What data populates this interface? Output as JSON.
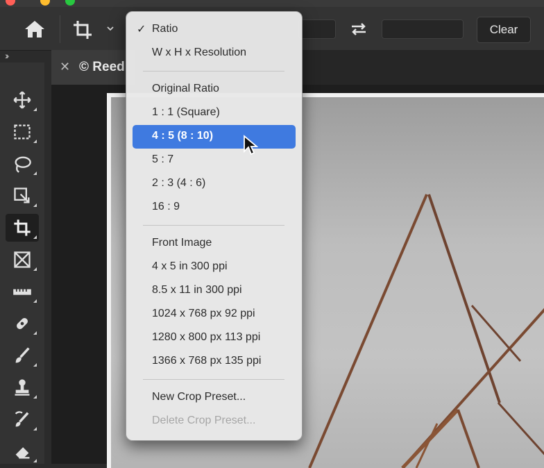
{
  "options_bar": {
    "clear_label": "Clear",
    "width_value": "",
    "height_value": ""
  },
  "document_tab": {
    "title": "© Reed"
  },
  "preset_menu": {
    "mode_items": [
      {
        "label": "Ratio",
        "checked": true
      },
      {
        "label": "W x H x Resolution",
        "checked": false
      }
    ],
    "ratio_items": [
      {
        "label": "Original Ratio"
      },
      {
        "label": "1 : 1 (Square)"
      },
      {
        "label": "4 : 5 (8 : 10)",
        "highlighted": true
      },
      {
        "label": "5 : 7"
      },
      {
        "label": "2 : 3 (4 : 6)"
      },
      {
        "label": "16 : 9"
      }
    ],
    "size_items": [
      {
        "label": "Front Image"
      },
      {
        "label": "4 x 5 in 300 ppi"
      },
      {
        "label": "8.5 x 11 in 300 ppi"
      },
      {
        "label": "1024 x 768 px 92 ppi"
      },
      {
        "label": "1280 x 800 px 113 ppi"
      },
      {
        "label": "1366 x 768 px 135 ppi"
      }
    ],
    "action_items": [
      {
        "label": "New Crop Preset...",
        "enabled": true
      },
      {
        "label": "Delete Crop Preset...",
        "enabled": false
      }
    ]
  },
  "tools": [
    {
      "icon": "move-icon"
    },
    {
      "icon": "rectangular-marquee-icon"
    },
    {
      "icon": "lasso-icon"
    },
    {
      "icon": "object-selection-icon"
    },
    {
      "icon": "crop-icon",
      "active": true
    },
    {
      "icon": "frame-icon"
    },
    {
      "icon": "ruler-icon"
    },
    {
      "icon": "healing-brush-icon"
    },
    {
      "icon": "brush-icon"
    },
    {
      "icon": "clone-stamp-icon"
    },
    {
      "icon": "history-brush-icon"
    },
    {
      "icon": "eraser-icon"
    }
  ],
  "colors": {
    "highlight": "#3f7ae0",
    "menu_background": "#e8e8e8",
    "app_background": "#2b2b2b"
  }
}
